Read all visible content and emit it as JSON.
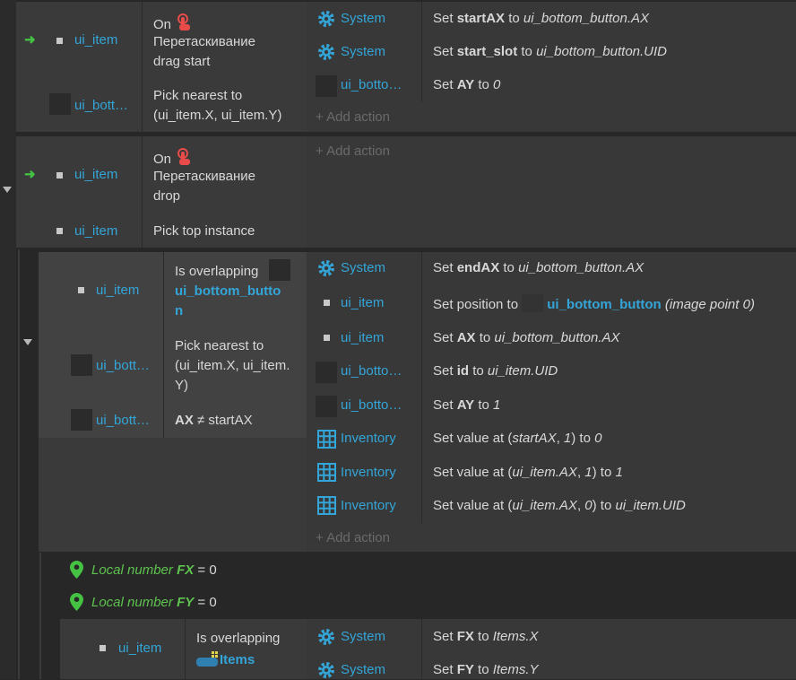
{
  "colors": {
    "object": "#33a5d8",
    "green": "#5ec24f",
    "bg": "#272727"
  },
  "e1": {
    "obj1": "ui_item",
    "cond1_on": "On",
    "cond1_l2": "Перетаскивание",
    "cond1_l3": "drag start",
    "obj2": "ui_bott…",
    "cond2_l1": "Pick nearest to",
    "cond2_l2": "(ui_item.X, ui_item.Y)",
    "a1_obj": "System",
    "a1_pre": "Set ",
    "a1_var": "startAX",
    "a1_mid": " to ",
    "a1_val": "ui_bottom_button.AX",
    "a2_obj": "System",
    "a2_pre": "Set ",
    "a2_var": "start_slot",
    "a2_mid": " to ",
    "a2_val": "ui_bottom_button.UID",
    "a3_obj": "ui_botto…",
    "a3_pre": "Set ",
    "a3_var": "AY",
    "a3_mid": " to ",
    "a3_val": "0",
    "add": "Add action"
  },
  "e2": {
    "obj1": "ui_item",
    "cond1_on": "On",
    "cond1_l2": "Перетаскивание",
    "cond1_l3": "drop",
    "obj2": "ui_item",
    "cond2": "Pick top instance",
    "add": "Add action"
  },
  "e3": {
    "obj1": "ui_item",
    "c1_l1": "Is overlapping",
    "c1_l2": "ui_bottom_butto",
    "c1_l3": "n",
    "obj2": "ui_bott…",
    "c2_l1": "Pick nearest to",
    "c2_l2": "(ui_item.X, ui_item.",
    "c2_l3": "Y)",
    "obj3": "ui_bott…",
    "c3_var": "AX",
    "c3_rest": " ≠ startAX",
    "a1_obj": "System",
    "a1_pre": "Set ",
    "a1_var": "endAX",
    "a1_mid": " to ",
    "a1_val": "ui_bottom_button.AX",
    "a2_obj": "ui_item",
    "a2_pre": "Set position to ",
    "a2_tgt": "ui_bottom_button",
    "a2_suf": " (image point 0)",
    "a3_obj": "ui_item",
    "a3_pre": "Set ",
    "a3_var": "AX",
    "a3_mid": " to ",
    "a3_val": "ui_bottom_button.AX",
    "a4_obj": "ui_botto…",
    "a4_pre": "Set ",
    "a4_var": "id",
    "a4_mid": " to ",
    "a4_val": "ui_item.UID",
    "a5_obj": "ui_botto…",
    "a5_pre": "Set ",
    "a5_var": "AY",
    "a5_mid": " to ",
    "a5_val": "1",
    "a6_obj": "Inventory",
    "a6_pre": "Set value at (",
    "a6_args": "startAX",
    "a6_mid": ", ",
    "a6_n": "1",
    "a6_close": ") to ",
    "a6_val": "0",
    "a7_obj": "Inventory",
    "a7_pre": "Set value at (",
    "a7_args": "ui_item.AX",
    "a7_mid": ", ",
    "a7_n": "1",
    "a7_close": ") to ",
    "a7_val": "1",
    "a8_obj": "Inventory",
    "a8_pre": "Set value at (",
    "a8_args": "ui_item.AX",
    "a8_mid": ", ",
    "a8_n": "0",
    "a8_close": ") to ",
    "a8_val": "ui_item.UID",
    "add": "Add action"
  },
  "locals": {
    "fx_pre": "Local number ",
    "fx_name": "FX",
    "fx_eq": " = 0",
    "fy_pre": "Local number ",
    "fy_name": "FY",
    "fy_eq": " = 0"
  },
  "e4": {
    "obj1": "ui_item",
    "c1_l1": "Is overlapping",
    "c1_l2": "Items",
    "a1_obj": "System",
    "a1_pre": "Set ",
    "a1_var": "FX",
    "a1_mid": " to ",
    "a1_val": "Items.X",
    "a2_obj": "System",
    "a2_pre": "Set ",
    "a2_var": "FY",
    "a2_mid": " to ",
    "a2_val": "Items.Y"
  },
  "icons": {
    "gear": "gear-icon",
    "touch": "touch-icon",
    "grid": "array-grid-icon",
    "pin": "local-variable-pin-icon",
    "sprite": "sprite-thumbnail-icon",
    "tilemap": "family-icon"
  }
}
